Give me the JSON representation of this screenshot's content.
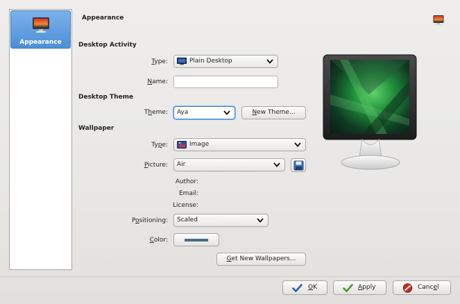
{
  "sidebar": {
    "items": [
      {
        "label": "Appearance",
        "icon": "monitor-sunset-icon",
        "selected": true
      }
    ]
  },
  "header": {
    "title": "Appearance",
    "corner_icon": "monitor-sunset-icon"
  },
  "desktop_activity": {
    "heading": "Desktop Activity",
    "type_label_pre": "",
    "type_label_u": "T",
    "type_label_post": "ype:",
    "type_value": "Plain Desktop",
    "name_label_u": "N",
    "name_label_post": "ame:",
    "name_value": ""
  },
  "desktop_theme": {
    "heading": "Desktop Theme",
    "theme_label_pre": "T",
    "theme_label_u": "h",
    "theme_label_post": "eme:",
    "theme_value": "Aya",
    "new_theme_u": "N",
    "new_theme_post": "ew Theme..."
  },
  "wallpaper": {
    "heading": "Wallpaper",
    "type_label_pre": "Ty",
    "type_label_u": "p",
    "type_label_post": "e:",
    "type_value": "Image",
    "picture_label_u": "P",
    "picture_label_post": "icture:",
    "picture_value": "Air",
    "author_label": "Author:",
    "email_label": "Email:",
    "license_label": "License:",
    "positioning_label_pre": "P",
    "positioning_label_u": "o",
    "positioning_label_post": "sitioning:",
    "positioning_value": "Scaled",
    "color_label_u": "C",
    "color_label_post": "olor:",
    "color_value": "#4a6d8c",
    "get_new_u": "G",
    "get_new_post": "et New Wallpapers..."
  },
  "dialog_buttons": {
    "ok_u": "O",
    "ok_post": "K",
    "apply_u": "A",
    "apply_post": "pply",
    "cancel_pre": "Canc",
    "cancel_u": "e",
    "cancel_post": "l"
  },
  "colors": {
    "selection": "#4d8fd6",
    "focus": "#3a83d2",
    "ok_check": "#2e5ea8",
    "apply_check": "#3f9b2a",
    "cancel_red": "#c8281e"
  }
}
